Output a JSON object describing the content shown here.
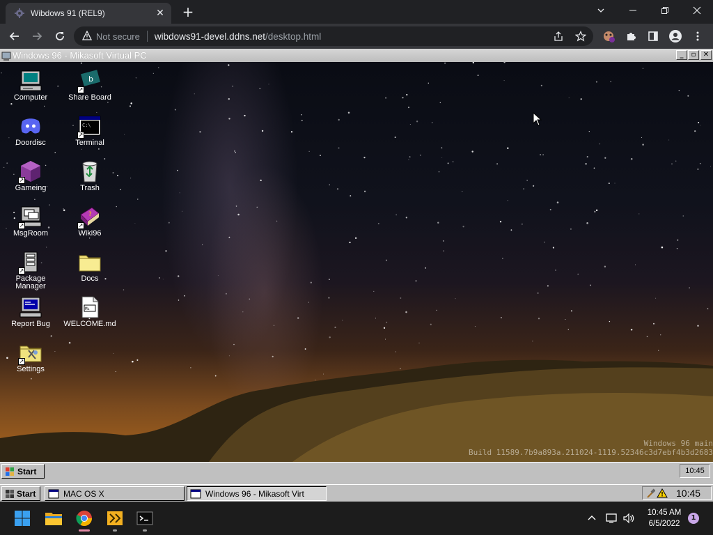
{
  "browser": {
    "tab_title": "Wibdows 91 (REL9)",
    "not_secure_label": "Not secure",
    "url_host": "wibdows91-devel.ddns.net",
    "url_path": "/desktop.html"
  },
  "vm_window": {
    "title": "Windows 96 - Mikasoft Virtual PC"
  },
  "desktop": {
    "icons": [
      {
        "label": "Computer"
      },
      {
        "label": "Share Board"
      },
      {
        "label": "Doordisc"
      },
      {
        "label": "Terminal"
      },
      {
        "label": "Gameing"
      },
      {
        "label": "Trash"
      },
      {
        "label": "MsgRoom"
      },
      {
        "label": "Wiki96"
      },
      {
        "label": "Package Manager"
      },
      {
        "label": "Docs"
      },
      {
        "label": "Report Bug"
      },
      {
        "label": "WELCOME.md"
      },
      {
        "label": "Settings"
      }
    ],
    "build_line1": "Windows 96 main",
    "build_line2": "Build 11589.7b9a893a.211024-1119.52346c3d7ebf4b3d2683"
  },
  "vm_taskbar": {
    "start_label": "Start",
    "clock": "10:45"
  },
  "host_taskbar": {
    "start_label": "Start",
    "items": [
      {
        "label": "MAC OS X"
      },
      {
        "label": "Windows 96 - Mikasoft Virt"
      }
    ],
    "clock": "10:45"
  },
  "windows_taskbar": {
    "time": "10:45 AM",
    "date": "6/5/2022",
    "notification_count": "1"
  },
  "icons": {
    "tab_favicon": "gear-favicon",
    "back": "arrow-left-icon",
    "forward": "arrow-right-icon",
    "reload": "reload-icon",
    "warning": "warning-triangle-icon",
    "share": "share-icon",
    "star": "star-icon",
    "extension": "puzzle-icon",
    "sidepanel": "sidepanel-icon",
    "profile": "profile-icon",
    "menu": "kebab-menu-icon"
  }
}
